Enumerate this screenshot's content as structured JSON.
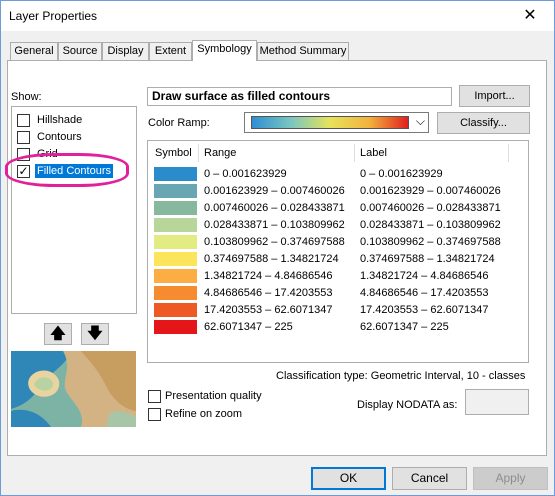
{
  "window": {
    "title": "Layer Properties",
    "close_glyph": "✕"
  },
  "tabs": [
    {
      "label": "General"
    },
    {
      "label": "Source"
    },
    {
      "label": "Display"
    },
    {
      "label": "Extent"
    },
    {
      "label": "Symbology",
      "active": true
    },
    {
      "label": "Method Summary"
    }
  ],
  "show": {
    "label": "Show:",
    "items": [
      {
        "label": "Hillshade",
        "checked": false
      },
      {
        "label": "Contours",
        "checked": false
      },
      {
        "label": "Grid",
        "checked": false
      },
      {
        "label": "Filled Contours",
        "checked": true,
        "selected": true
      }
    ]
  },
  "move_buttons": {
    "up_icon": "arrow-up-icon",
    "down_icon": "arrow-down-icon"
  },
  "renderer": {
    "title": "Draw surface as filled contours",
    "import_label": "Import..."
  },
  "color_ramp": {
    "label": "Color Ramp:",
    "classify_label": "Classify...",
    "colors": [
      "#2f8fd2",
      "#7ac6c0",
      "#e6e35a",
      "#f3b33e",
      "#e2201d"
    ]
  },
  "table": {
    "headers": {
      "symbol": "Symbol",
      "range": "Range",
      "label": "Label"
    },
    "rows": [
      {
        "color": "#2b8ccc",
        "range": "0 – 0.001623929",
        "label": "0 – 0.001623929"
      },
      {
        "color": "#68a6b3",
        "range": "0.001623929 – 0.007460026",
        "label": "0.001623929 – 0.007460026"
      },
      {
        "color": "#86b89e",
        "range": "0.007460026 – 0.028433871",
        "label": "0.007460026 – 0.028433871"
      },
      {
        "color": "#b8d59a",
        "range": "0.028433871 – 0.103809962",
        "label": "0.028433871 – 0.103809962"
      },
      {
        "color": "#e3ec82",
        "range": "0.103809962 – 0.374697588",
        "label": "0.103809962 – 0.374697588"
      },
      {
        "color": "#fde55b",
        "range": "0.374697588 – 1.34821724",
        "label": "0.374697588 – 1.34821724"
      },
      {
        "color": "#fcae44",
        "range": "1.34821724 – 4.84686546",
        "label": "1.34821724 – 4.84686546"
      },
      {
        "color": "#f58c30",
        "range": "4.84686546 – 17.4203553",
        "label": "4.84686546 – 17.4203553"
      },
      {
        "color": "#ee5a24",
        "range": "17.4203553 – 62.6071347",
        "label": "17.4203553 – 62.6071347"
      },
      {
        "color": "#e5161a",
        "range": "62.6071347 – 225",
        "label": "62.6071347 – 225"
      }
    ]
  },
  "classification": {
    "text": "Classification type: Geometric Interval,     10 - classes"
  },
  "options": {
    "presentation_quality": "Presentation quality",
    "refine_on_zoom": "Refine on zoom",
    "nodata_label": "Display NODATA as:"
  },
  "footer": {
    "ok": "OK",
    "cancel": "Cancel",
    "apply": "Apply"
  }
}
